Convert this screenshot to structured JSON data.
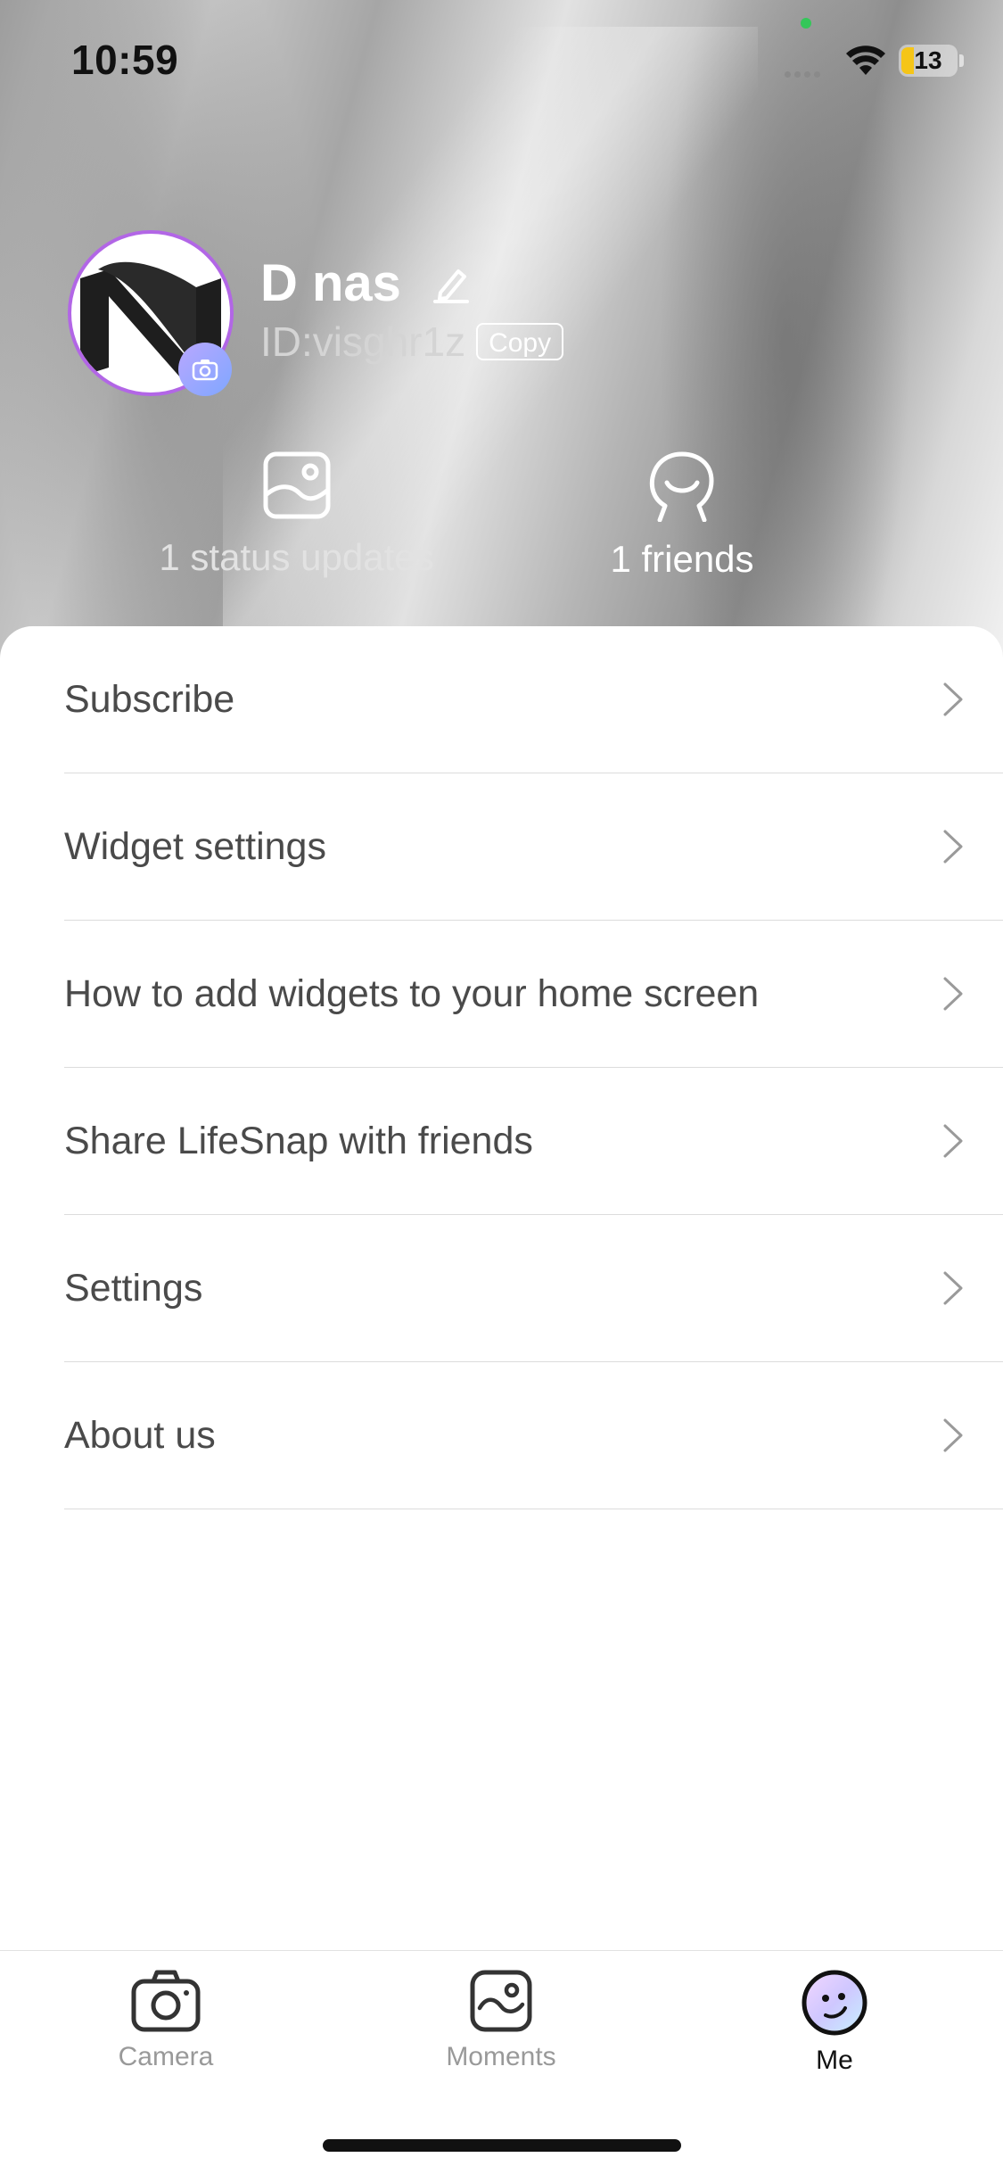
{
  "status_bar": {
    "time": "10:59",
    "battery": "13"
  },
  "profile": {
    "name": "D nas",
    "id": "ID:visghr1z",
    "copy_label": "Copy"
  },
  "stats": [
    {
      "icon": "photo-icon",
      "label": "1 status updates"
    },
    {
      "icon": "friends-icon",
      "label": "1 friends"
    }
  ],
  "menu": {
    "items": [
      {
        "label": "Subscribe"
      },
      {
        "label": "Widget settings"
      },
      {
        "label": "How to add widgets to your home screen"
      },
      {
        "label": "Share LifeSnap with friends"
      },
      {
        "label": "Settings"
      },
      {
        "label": "About us"
      }
    ]
  },
  "tabbar": {
    "tabs": [
      {
        "label": "Camera",
        "icon": "camera-icon"
      },
      {
        "label": "Moments",
        "icon": "moments-icon"
      },
      {
        "label": "Me",
        "icon": "me-face-icon",
        "active": true
      }
    ]
  },
  "colors": {
    "accent": "#b266e6",
    "menu_text": "#4a4a4a",
    "divider": "#dcdcdc",
    "inactive_tab": "#999999"
  }
}
